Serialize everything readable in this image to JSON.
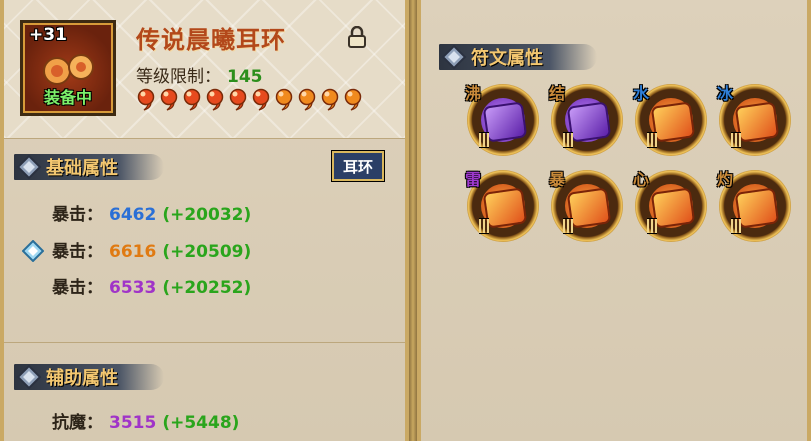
{
  "item": {
    "plus": "+31",
    "equipped": "装备中",
    "name": "传说晨曦耳环",
    "level_label": "等级限制：",
    "level_value": "145",
    "star_count": 10,
    "star_colors": [
      "#e64a1e",
      "#e64a1e",
      "#e64a1e",
      "#e64a1e",
      "#e64a1e",
      "#e64a1e",
      "#f08a1e",
      "#f08a1e",
      "#f08a1e",
      "#f08a1e"
    ],
    "lock_icon": "lock-icon"
  },
  "basic": {
    "title": "基础属性",
    "button": "耳环",
    "stats": [
      {
        "label": "暴击：",
        "value": "6462",
        "bonus": "(+20032)",
        "color": "#2a6fd6"
      },
      {
        "label": "暴击：",
        "value": "6616",
        "bonus": "(+20509)",
        "color": "#e07a12"
      },
      {
        "label": "暴击：",
        "value": "6533",
        "bonus": "(+20252)",
        "color": "#a034c8"
      }
    ]
  },
  "aux": {
    "title": "辅助属性",
    "stats": [
      {
        "label": "抗魔：",
        "value": "3515",
        "bonus": "(+5448)",
        "color": "#a034c8"
      }
    ]
  },
  "runes": {
    "title": "符文属性",
    "items": [
      {
        "tag": "沸",
        "tag_color": "#c98a3a",
        "gem": "purple"
      },
      {
        "tag": "结",
        "tag_color": "#c98a3a",
        "gem": "purple"
      },
      {
        "tag": "水",
        "tag_color": "#2f7fd8",
        "gem": "orange"
      },
      {
        "tag": "冰",
        "tag_color": "#2f7fd8",
        "gem": "orange"
      },
      {
        "tag": "雷",
        "tag_color": "#a03ad0",
        "gem": "orange"
      },
      {
        "tag": "暴",
        "tag_color": "#c98a3a",
        "gem": "orange"
      },
      {
        "tag": "心",
        "tag_color": "#c98a3a",
        "gem": "orange"
      },
      {
        "tag": "灼",
        "tag_color": "#c98a3a",
        "gem": "orange"
      }
    ]
  }
}
